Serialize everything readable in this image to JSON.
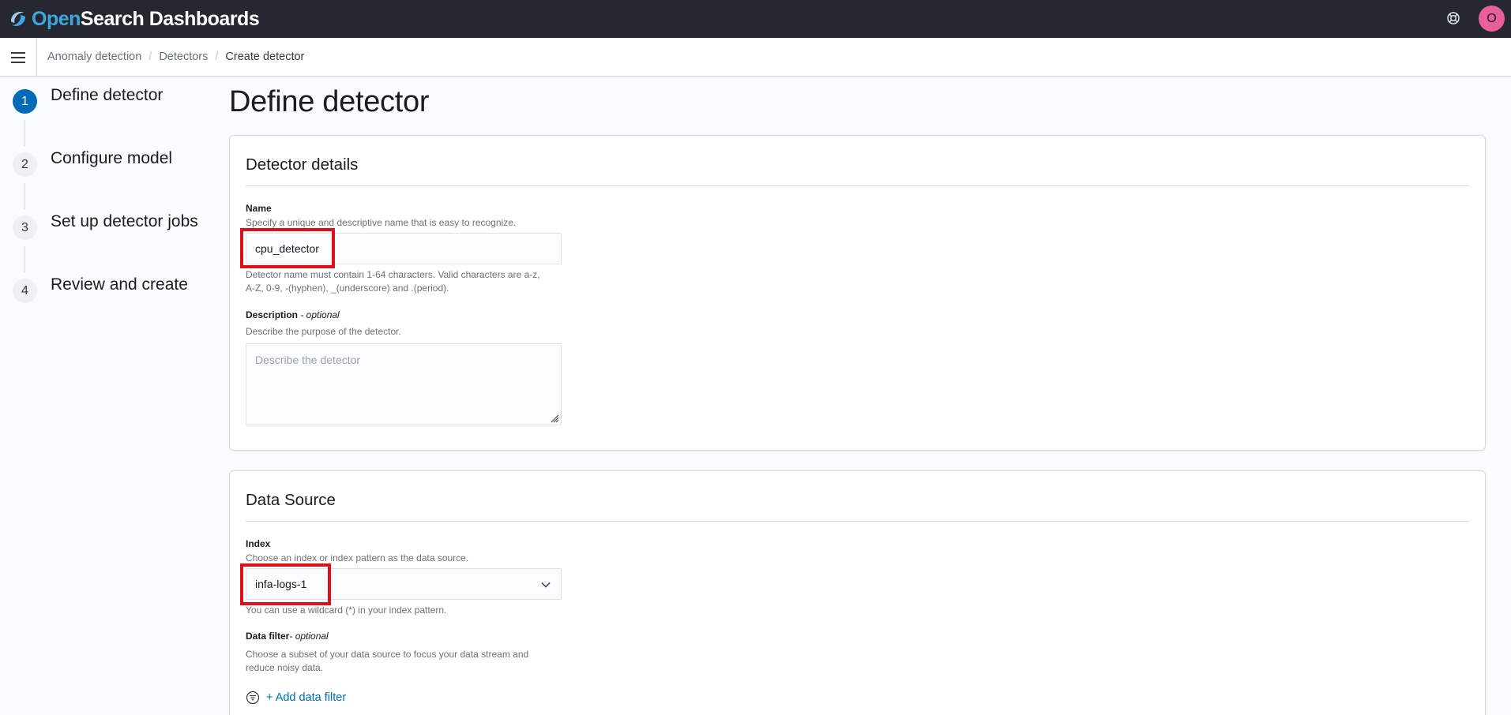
{
  "header": {
    "logo_open": "Open",
    "logo_rest": "Search Dashboards",
    "avatar_initial": "O"
  },
  "breadcrumbs": [
    {
      "label": "Anomaly detection"
    },
    {
      "label": "Detectors"
    },
    {
      "label": "Create detector"
    }
  ],
  "steps": [
    {
      "number": "1",
      "label": "Define detector",
      "active": true
    },
    {
      "number": "2",
      "label": "Configure model",
      "active": false
    },
    {
      "number": "3",
      "label": "Set up detector jobs",
      "active": false
    },
    {
      "number": "4",
      "label": "Review and create",
      "active": false
    }
  ],
  "page_title": "Define detector",
  "detector_details": {
    "title": "Detector details",
    "name_label": "Name",
    "name_help": "Specify a unique and descriptive name that is easy to recognize.",
    "name_value": "cpu_detector",
    "name_rules_line1": "Detector name must contain 1-64 characters. Valid characters are a-z,",
    "name_rules_line2": "A-Z, 0-9, -(hyphen), _(underscore) and .(period).",
    "description_label": "Description",
    "description_optional": " - optional",
    "description_help": "Describe the purpose of the detector.",
    "description_placeholder": "Describe the detector"
  },
  "data_source": {
    "title": "Data Source",
    "index_label": "Index",
    "index_help": "Choose an index or index pattern as the data source.",
    "index_value": "infa-logs-1",
    "index_wildcard_help": "You can use a wildcard (*) in your index pattern.",
    "filter_label": "Data filter",
    "filter_optional": "- optional",
    "filter_help_line1": "Choose a subset of your data source to focus your data stream and",
    "filter_help_line2": "reduce noisy data.",
    "add_filter_label": "+ Add data filter"
  },
  "colors": {
    "header_bg": "#25282f",
    "accent": "#006bb8",
    "highlight": "#e0101b",
    "avatar": "#e7609b"
  }
}
